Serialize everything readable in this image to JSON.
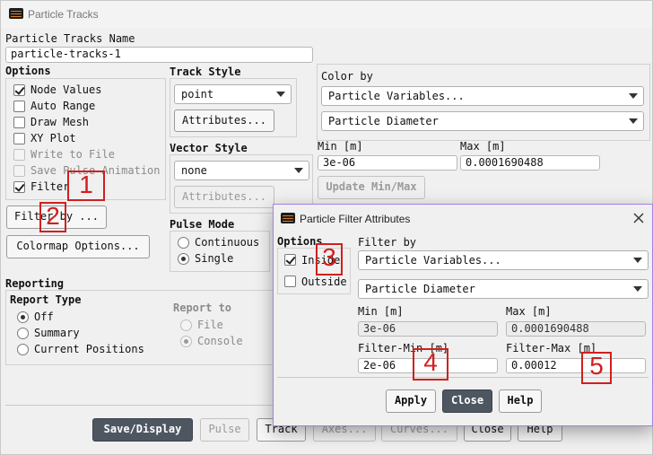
{
  "window": {
    "title": "Particle Tracks"
  },
  "name_section": {
    "label": "Particle Tracks Name",
    "value": "particle-tracks-1"
  },
  "options": {
    "label": "Options",
    "items": [
      {
        "label": "Node Values",
        "checked": true,
        "enabled": true
      },
      {
        "label": "Auto Range",
        "checked": false,
        "enabled": true
      },
      {
        "label": "Draw Mesh",
        "checked": false,
        "enabled": true
      },
      {
        "label": "XY Plot",
        "checked": false,
        "enabled": true
      },
      {
        "label": "Write to File",
        "checked": false,
        "enabled": false
      },
      {
        "label": "Save Pulse Animation",
        "checked": false,
        "enabled": false
      },
      {
        "label": "Filter",
        "checked": true,
        "enabled": true
      }
    ],
    "filter_by_button": "Filter by ...",
    "colormap_button": "Colormap Options..."
  },
  "track_style": {
    "label": "Track Style",
    "value": "point",
    "attributes_button": "Attributes..."
  },
  "vector_style": {
    "label": "Vector Style",
    "value": "none",
    "attributes_button": "Attributes..."
  },
  "pulse_mode": {
    "label": "Pulse Mode",
    "options": [
      "Continuous",
      "Single"
    ],
    "selected": "Single"
  },
  "color_by": {
    "label": "Color by",
    "variable": "Particle Variables...",
    "field": "Particle Diameter",
    "min_label": "Min [m]",
    "min_value": "3e-06",
    "max_label": "Max [m]",
    "max_value": "0.0001690488",
    "update_button": "Update Min/Max"
  },
  "reporting": {
    "label": "Reporting",
    "type_label": "Report Type",
    "types": [
      "Off",
      "Summary",
      "Current Positions"
    ],
    "selected": "Off",
    "to_label": "Report to",
    "targets": [
      "File",
      "Console"
    ],
    "target_selected": "Console"
  },
  "bottom_buttons": [
    "Save/Display",
    "Pulse",
    "Track",
    "Axes...",
    "Curves...",
    "Close",
    "Help"
  ],
  "filter_dialog": {
    "title": "Particle Filter Attributes",
    "options_label": "Options",
    "inside_label": "Inside",
    "inside_checked": true,
    "outside_label": "Outside",
    "outside_checked": false,
    "filter_by_label": "Filter by",
    "variable": "Particle Variables...",
    "field": "Particle Diameter",
    "min_label": "Min [m]",
    "min_value": "3e-06",
    "max_label": "Max [m]",
    "max_value": "0.0001690488",
    "filter_min_label": "Filter-Min [m]",
    "filter_min_value": "2e-06",
    "filter_max_label": "Filter-Max [m]",
    "filter_max_value": "0.00012",
    "apply_button": "Apply",
    "close_button": "Close",
    "help_button": "Help"
  },
  "annotations": [
    "1",
    "2",
    "3",
    "4",
    "5"
  ],
  "colors": {
    "accent_border": "#a77fe1",
    "primary_button": "#4e5662",
    "annotation": "#d11f1f"
  }
}
